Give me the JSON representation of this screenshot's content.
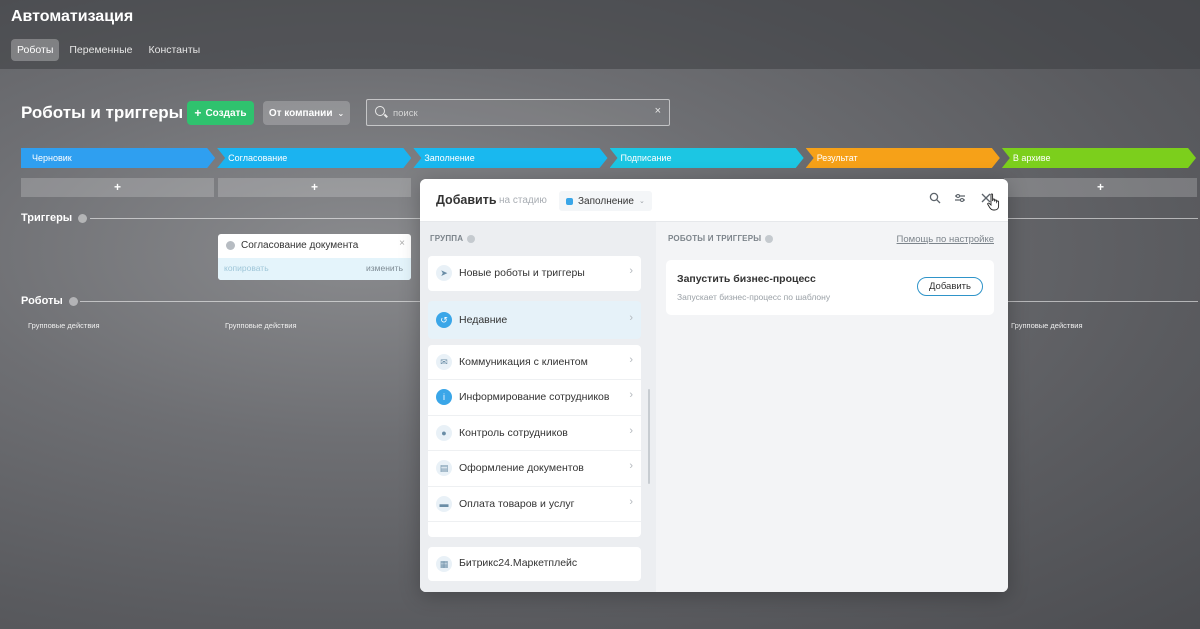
{
  "app": {
    "title": "Автоматизация",
    "tabs": [
      {
        "label": "Роботы",
        "active": true
      },
      {
        "label": "Переменные",
        "active": false
      },
      {
        "label": "Константы",
        "active": false
      }
    ]
  },
  "header": {
    "title": "Роботы и триггеры",
    "create_label": "Создать",
    "company_label": "От компании",
    "search_placeholder": "поиск"
  },
  "stages": [
    {
      "label": "Черновик",
      "color": "#2f9ff0"
    },
    {
      "label": "Согласование",
      "color": "#1bb3f0"
    },
    {
      "label": "Заполнение",
      "color": "#19b8ef"
    },
    {
      "label": "Подписание",
      "color": "#1cc6e3"
    },
    {
      "label": "Результат",
      "color": "#f6a118"
    },
    {
      "label": "В архиве",
      "color": "#7ccf1c"
    }
  ],
  "add_symbol": "+",
  "triggers": {
    "label": "Триггеры",
    "card": {
      "title": "Согласование документа",
      "copy_label": "копировать",
      "edit_label": "изменить"
    }
  },
  "robots": {
    "label": "Роботы",
    "group_actions_label": "Групповые действия"
  },
  "modal": {
    "title": "Добавить",
    "subtitle": "на стадию",
    "stage": "Заполнение",
    "group_header": "ГРУППА",
    "right_header": "РОБОТЫ И ТРИГГЕРЫ",
    "help_link": "Помощь по настройке",
    "top_groups": [
      {
        "label": "Новые роботы и триггеры",
        "icon": "send-icon"
      },
      {
        "label": "Недавние",
        "icon": "history-icon"
      }
    ],
    "groups": [
      {
        "label": "Коммуникация с клиентом",
        "icon": "chat-icon"
      },
      {
        "label": "Информирование сотрудников",
        "icon": "info-icon"
      },
      {
        "label": "Контроль сотрудников",
        "icon": "users-icon"
      },
      {
        "label": "Оформление документов",
        "icon": "document-icon"
      },
      {
        "label": "Оплата товаров и услуг",
        "icon": "wallet-icon"
      }
    ],
    "marketplace": "Битрикс24.Маркетплейс",
    "robot": {
      "title": "Запустить бизнес-процесс",
      "description": "Запускает бизнес-процесс по шаблону",
      "button": "Добавить"
    }
  },
  "colors": {
    "create_button": "#2fc26e",
    "accent": "#2f94c9"
  }
}
